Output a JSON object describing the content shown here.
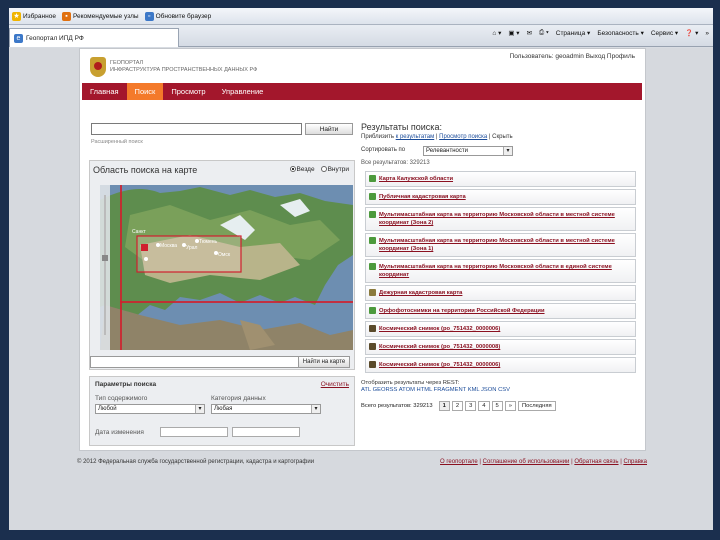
{
  "browser": {
    "favorites_bar": {
      "favorites": "Избранное",
      "recommended": "Рекомендуемые узлы",
      "update": "Обновите браузер"
    },
    "tab": {
      "title": "Геопортал ИПД РФ"
    },
    "command_bar": {
      "page": "Страница",
      "security": "Безопасность",
      "service": "Сервис",
      "more": "»"
    }
  },
  "page": {
    "user_bar": "Пользователь: geoadmin  Выход  Профиль",
    "logo": {
      "line1": "Геопортал",
      "line2": "инфраструктура пространственных данных РФ"
    },
    "nav": [
      "Главная",
      "Поиск",
      "Просмотр",
      "Управление"
    ],
    "nav_active": 1,
    "search": {
      "value": "",
      "button": "Найти",
      "advanced_link": "Расширенный поиск"
    },
    "map_panel": {
      "title": "Область поиска на карте",
      "opt_all": "Везде",
      "opt_inside": "Внутри",
      "selected": "all",
      "find_button": "Найти на карте",
      "map_labels": [
        "Москва",
        "Санкт",
        "Тюмень",
        "Омск",
        "Урал"
      ]
    },
    "params": {
      "title": "Параметры поиска",
      "clear": "Очистить",
      "content_type_label": "Тип содержимого",
      "content_type_value": "Любой",
      "data_category_label": "Категория данных",
      "data_category_value": "Любая",
      "date_label": "Дата изменения"
    },
    "results": {
      "title": "Результаты поиска:",
      "actions_prefix": "Приблизить",
      "action_zoom": "к результатам",
      "action_details": "Просмотр поиска",
      "action_hide": "Скрыть",
      "sort_label": "Сортировать по",
      "sort_value": "Релевантности",
      "count_top": "Все результатов: 329213",
      "items": [
        {
          "title": "Карта Калужской области",
          "icon": "map"
        },
        {
          "title": "Публичная кадастровая карта",
          "icon": "map"
        },
        {
          "title": "Мультимасштабная карта на территорию Московской области в местной системе координат (Зона 2)",
          "icon": "map"
        },
        {
          "title": "Мультимасштабная карта на территорию Московской области в местной системе координат (Зона 1)",
          "icon": "map"
        },
        {
          "title": "Мультимасштабная карта на территорию Московской области в единой системе координат",
          "icon": "map"
        },
        {
          "title": "Дежурная кадастровая карта",
          "icon": "img"
        },
        {
          "title": "Орфофотоснимки на территории Российской Федерации",
          "icon": "map"
        },
        {
          "title": "Космический снимок (ро_751432_0000006)",
          "icon": "drk"
        },
        {
          "title": "Космический снимок (ро_751432_0000008)",
          "icon": "drk"
        },
        {
          "title": "Космический снимок (ро_751432_0000006)",
          "icon": "drk"
        }
      ],
      "formats_line1": "Отобразить результаты через REST:",
      "formats_line2": "ATL  GEORSS  ATOM  HTML  FRAGMENT  KML  JSON  CSV",
      "count_bottom": "Всего результатов: 329213",
      "pages": [
        "1",
        "2",
        "3",
        "4",
        "5",
        "»",
        "Последняя"
      ]
    },
    "footer": {
      "left": "© 2012 Федеральная служба государственной регистрации, кадастра и картографии",
      "about": "О геопортале",
      "terms": "Соглашение об использовании",
      "feedback": "Обратная связь",
      "help": "Справка"
    }
  },
  "colors": {
    "nav_bg": "#a3172c",
    "nav_active": "#f47a2a",
    "link": "#8a1020",
    "bezel": "#1b2f4e"
  }
}
